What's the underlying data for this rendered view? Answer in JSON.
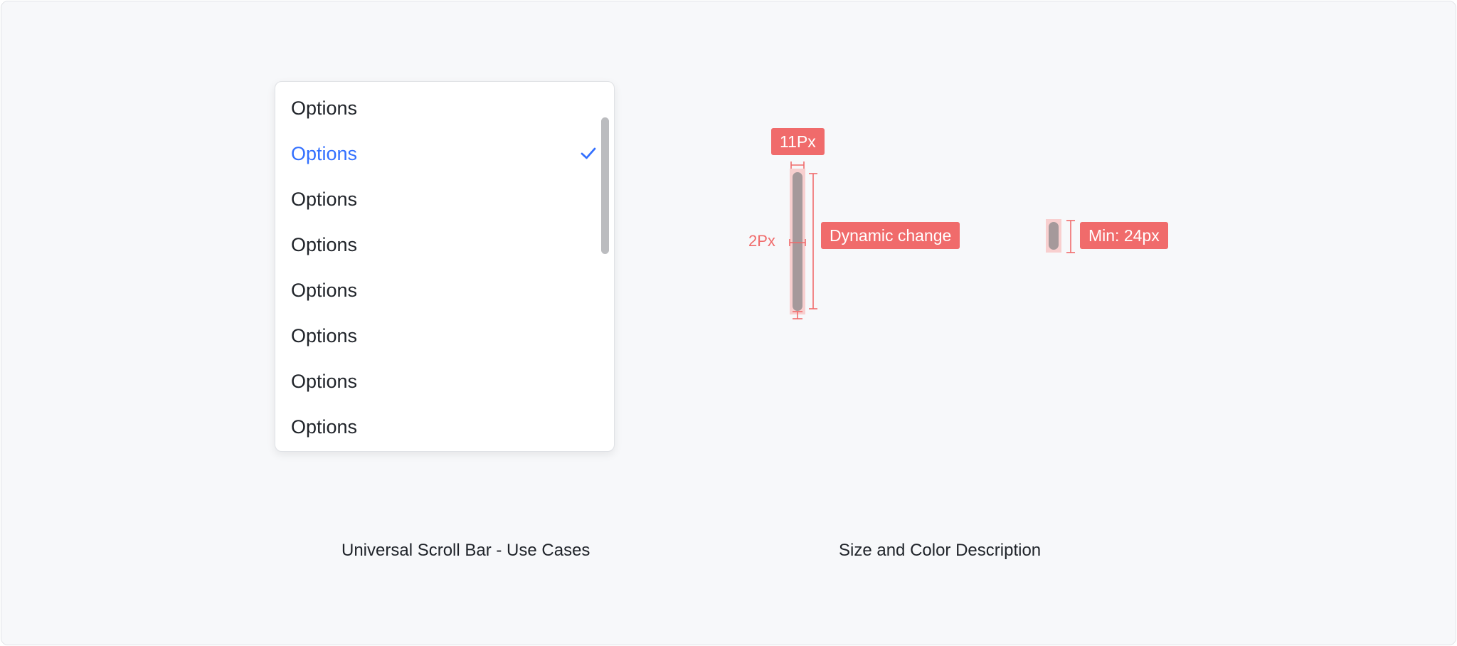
{
  "dropdown": {
    "options": [
      {
        "label": "Options",
        "selected": false
      },
      {
        "label": "Options",
        "selected": true
      },
      {
        "label": "Options",
        "selected": false
      },
      {
        "label": "Options",
        "selected": false
      },
      {
        "label": "Options",
        "selected": false
      },
      {
        "label": "Options",
        "selected": false
      },
      {
        "label": "Options",
        "selected": false
      },
      {
        "label": "Options",
        "selected": false
      }
    ],
    "check_icon": "checkmark-icon"
  },
  "spec": {
    "width_label": "11Px",
    "gap_label": "2Px",
    "dynamic_label": "Dynamic change",
    "min_label": "Min: 24px"
  },
  "captions": {
    "use_cases": "Universal Scroll Bar - Use Cases",
    "size_color": "Size and Color Description"
  },
  "colors": {
    "accent": "#3370ff",
    "annotation": "#f06b6b",
    "thumb": "#bbbcbf",
    "thumb_spec": "#a5999b",
    "highlight": "#f8cfcf",
    "text": "#1f2329"
  }
}
